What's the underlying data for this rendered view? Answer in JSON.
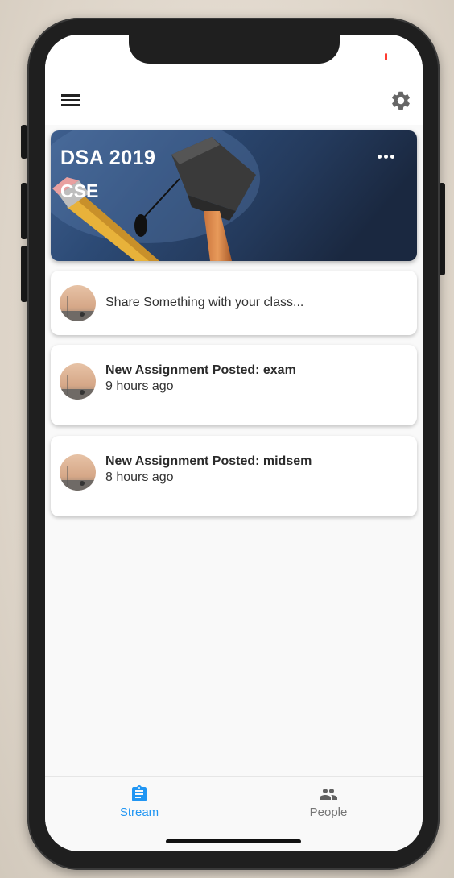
{
  "class": {
    "title": "DSA 2019",
    "subtitle": "CSE"
  },
  "share": {
    "placeholder": "Share Something with your class..."
  },
  "posts": [
    {
      "title": "New Assignment Posted: exam",
      "time": "9 hours ago"
    },
    {
      "title": "New Assignment Posted: midsem",
      "time": "8 hours ago"
    }
  ],
  "bottom_nav": {
    "items": [
      {
        "label": "Stream",
        "icon": "assignment-icon",
        "active": true
      },
      {
        "label": "People",
        "icon": "people-icon",
        "active": false
      }
    ]
  },
  "colors": {
    "accent": "#2196f3",
    "inactive": "#757575"
  }
}
